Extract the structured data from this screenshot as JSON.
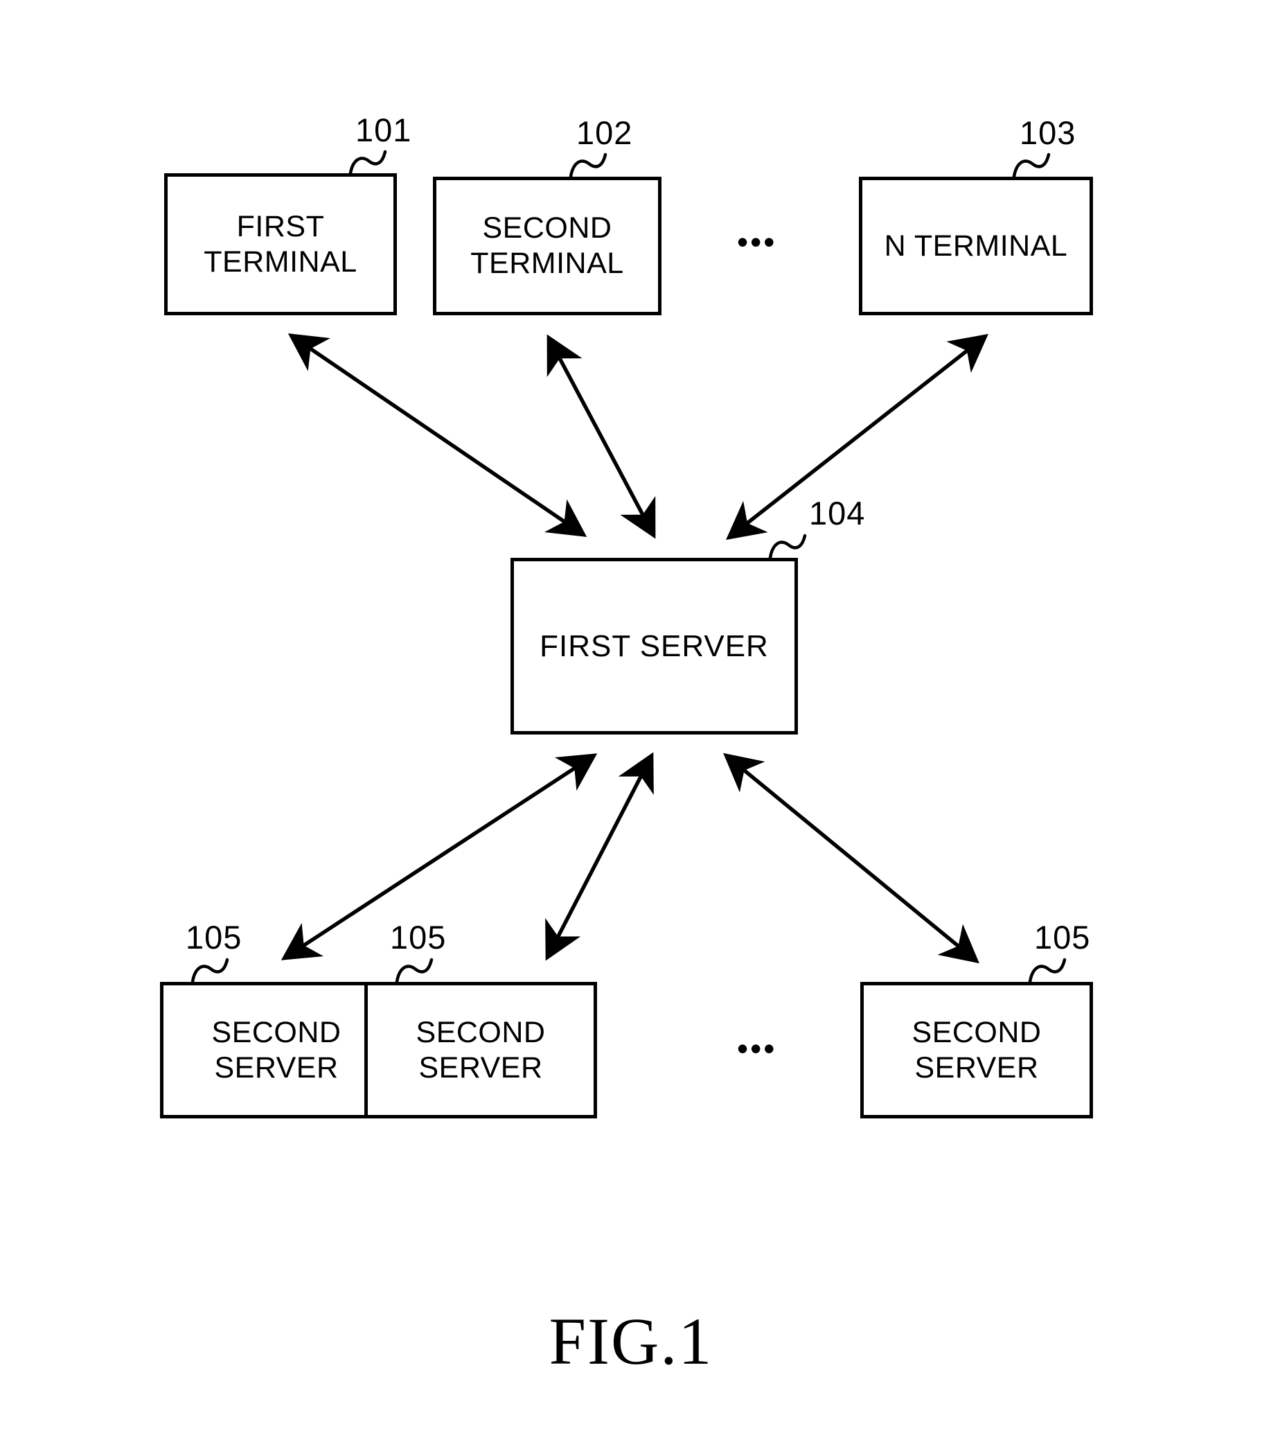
{
  "figure": {
    "caption": "FIG.1",
    "background_color": "#ffffff",
    "line_color": "#000000"
  },
  "nodes": {
    "terminals": [
      {
        "label": "FIRST\nTERMINAL",
        "ref": "101"
      },
      {
        "label": "SECOND\nTERMINAL",
        "ref": "102"
      },
      {
        "label": "N TERMINAL",
        "ref": "103"
      }
    ],
    "first_server": {
      "label": "FIRST SERVER",
      "ref": "104"
    },
    "second_servers": [
      {
        "label": "SECOND\nSERVER",
        "ref": "105"
      },
      {
        "label": "SECOND\nSERVER",
        "ref": "105"
      },
      {
        "label": "SECOND\nSERVER",
        "ref": "105"
      }
    ]
  },
  "ellipses": {
    "terminal_row": "•••",
    "server_row": "•••"
  },
  "connections": [
    {
      "from": "first-terminal",
      "to": "first-server",
      "style": "double-arrow"
    },
    {
      "from": "second-terminal",
      "to": "first-server",
      "style": "double-arrow"
    },
    {
      "from": "n-terminal",
      "to": "first-server",
      "style": "double-arrow"
    },
    {
      "from": "first-server",
      "to": "second-server-1",
      "style": "double-arrow"
    },
    {
      "from": "first-server",
      "to": "second-server-2",
      "style": "double-arrow"
    },
    {
      "from": "first-server",
      "to": "second-server-3",
      "style": "double-arrow"
    }
  ]
}
